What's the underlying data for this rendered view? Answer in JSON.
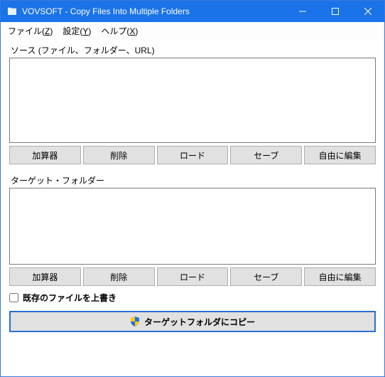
{
  "window": {
    "title": "VOVSOFT - Copy Files Into Multiple Folders"
  },
  "menubar": {
    "file": {
      "label": "ファイル",
      "mnemonic": "Z"
    },
    "settings": {
      "label": "設定",
      "mnemonic": "Y"
    },
    "help": {
      "label": "ヘルプ",
      "mnemonic": "X"
    }
  },
  "source": {
    "label": "ソース (ファイル、フォルダー、URL)",
    "buttons": {
      "add": "加算器",
      "remove": "削除",
      "load": "ロード",
      "save": "セーブ",
      "edit": "自由に編集"
    }
  },
  "target": {
    "label": "ターゲット・フォルダー",
    "buttons": {
      "add": "加算器",
      "remove": "削除",
      "load": "ロード",
      "save": "セーブ",
      "edit": "自由に編集"
    }
  },
  "overwrite": {
    "label": "既存のファイルを上書き",
    "checked": false
  },
  "copyButton": {
    "label": "ターゲットフォルダにコピー"
  }
}
